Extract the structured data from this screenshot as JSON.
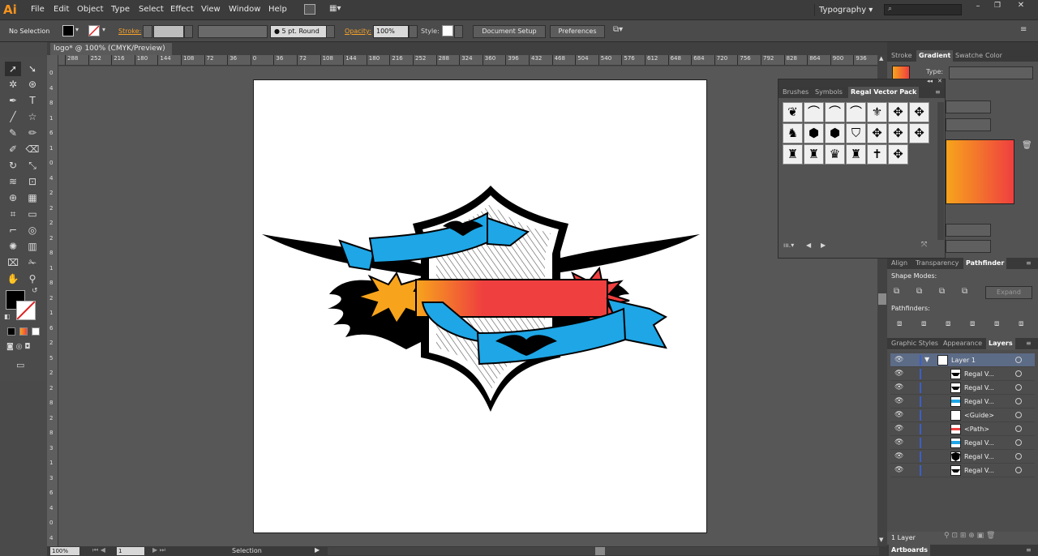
{
  "app": {
    "logo": "Ai"
  },
  "menu": [
    "File",
    "Edit",
    "Object",
    "Type",
    "Select",
    "Effect",
    "View",
    "Window",
    "Help"
  ],
  "workspace": {
    "name": "Typography"
  },
  "control": {
    "selection": "No Selection",
    "stroke_label": "Stroke:",
    "brush": "5 pt. Round",
    "opacity_label": "Opacity:",
    "opacity": "100%",
    "style_label": "Style:",
    "document_setup": "Document Setup",
    "preferences": "Preferences"
  },
  "document": {
    "tab": "logo* @ 100% (CMYK/Preview)"
  },
  "ruler": [
    "288",
    "252",
    "216",
    "180",
    "144",
    "108",
    "72",
    "36",
    "0",
    "36",
    "72",
    "108",
    "144",
    "180",
    "216",
    "252",
    "288",
    "324",
    "360",
    "396",
    "432",
    "468",
    "504",
    "540",
    "576",
    "612",
    "648",
    "684",
    "720",
    "756",
    "792",
    "828",
    "864",
    "900",
    "936"
  ],
  "vruler": [
    "0",
    "4",
    "8",
    "1",
    "6",
    "1",
    "0",
    "4",
    "2",
    "2",
    "2",
    "2",
    "8",
    "1",
    "8",
    "2",
    "1",
    "6",
    "2",
    "5",
    "2",
    "2",
    "8",
    "2",
    "8",
    "3",
    "1",
    "3",
    "6",
    "4",
    "0",
    "4"
  ],
  "status": {
    "zoom": "100%",
    "page": "1",
    "mode": "Selection"
  },
  "gradient_panel": {
    "tabs": [
      "Stroke",
      "Gradient",
      "Swatche",
      "Color"
    ],
    "type_label": "Type:",
    "colors": {
      "start": "#f7a41c",
      "end": "#ef3f3f"
    }
  },
  "symbols_panel": {
    "tabs": [
      "Brushes",
      "Symbols",
      "Regal Vector Pack"
    ]
  },
  "pathfinder_panel": {
    "tabs": [
      "Align",
      "Transparency",
      "Pathfinder"
    ],
    "shape_modes_label": "Shape Modes:",
    "expand": "Expand",
    "pathfinders_label": "Pathfinders:"
  },
  "layers_panel": {
    "tabs": [
      "Graphic Styles",
      "Appearance",
      "Layers"
    ],
    "rows": [
      {
        "name": "Layer 1",
        "icon": "layer"
      },
      {
        "name": "Regal V...",
        "icon": "wings"
      },
      {
        "name": "Regal V...",
        "icon": "wings"
      },
      {
        "name": "Regal V...",
        "icon": "ribbon"
      },
      {
        "name": "<Guide>",
        "icon": "blank"
      },
      {
        "name": "<Path>",
        "icon": "banner"
      },
      {
        "name": "Regal V...",
        "icon": "ribbon"
      },
      {
        "name": "Regal V...",
        "icon": "shield"
      },
      {
        "name": "Regal V...",
        "icon": "wings"
      }
    ],
    "footer": "1 Layer"
  },
  "artboards_panel": {
    "tab": "Artboards"
  },
  "art_colors": {
    "ribbon": "#1ea6e6",
    "banner_start": "#f7a41c",
    "banner_end": "#ef3f3f"
  }
}
